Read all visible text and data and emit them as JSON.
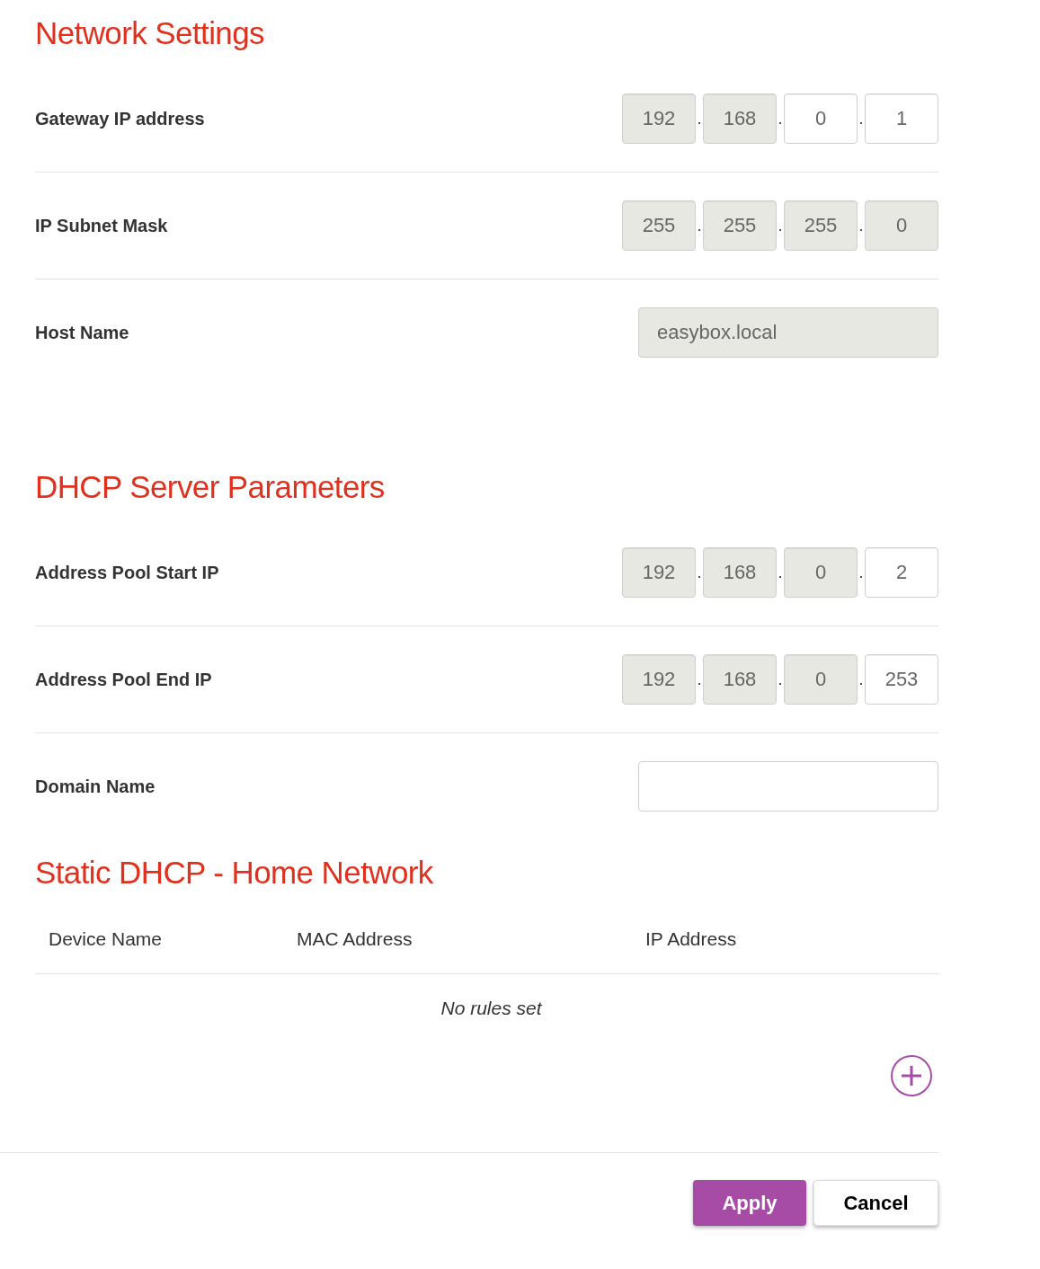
{
  "sections": [
    {
      "kind": "form",
      "title": "Network Settings",
      "rows": [
        {
          "kind": "ip",
          "label": "Gateway IP address",
          "separator": ".",
          "octets": [
            {
              "value": "192",
              "disabled": true
            },
            {
              "value": "168",
              "disabled": true
            },
            {
              "value": "0",
              "disabled": false
            },
            {
              "value": "1",
              "disabled": false
            }
          ]
        },
        {
          "kind": "ip",
          "label": "IP Subnet Mask",
          "separator": ".",
          "octets": [
            {
              "value": "255",
              "disabled": true
            },
            {
              "value": "255",
              "disabled": true
            },
            {
              "value": "255",
              "disabled": true
            },
            {
              "value": "0",
              "disabled": true
            }
          ]
        },
        {
          "kind": "text",
          "label": "Host Name",
          "value": "easybox.local",
          "disabled": true
        }
      ]
    },
    {
      "kind": "form",
      "title": "DHCP Server Parameters",
      "rows": [
        {
          "kind": "ip",
          "label": "Address Pool Start IP",
          "separator": ".",
          "octets": [
            {
              "value": "192",
              "disabled": true
            },
            {
              "value": "168",
              "disabled": true
            },
            {
              "value": "0",
              "disabled": true
            },
            {
              "value": "2",
              "disabled": false
            }
          ]
        },
        {
          "kind": "ip",
          "label": "Address Pool End IP",
          "separator": ".",
          "octets": [
            {
              "value": "192",
              "disabled": true
            },
            {
              "value": "168",
              "disabled": true
            },
            {
              "value": "0",
              "disabled": true
            },
            {
              "value": "253",
              "disabled": false
            }
          ]
        },
        {
          "kind": "text",
          "label": "Domain Name",
          "disabled": false
        }
      ]
    },
    {
      "kind": "table",
      "title": "Static DHCP - Home Network",
      "columns": [
        "Device Name",
        "MAC Address",
        "IP Address"
      ],
      "empty_message": "No rules set"
    }
  ],
  "buttons": [
    {
      "label": "Apply",
      "kind": "primary"
    },
    {
      "label": "Cancel",
      "kind": "secondary"
    }
  ]
}
